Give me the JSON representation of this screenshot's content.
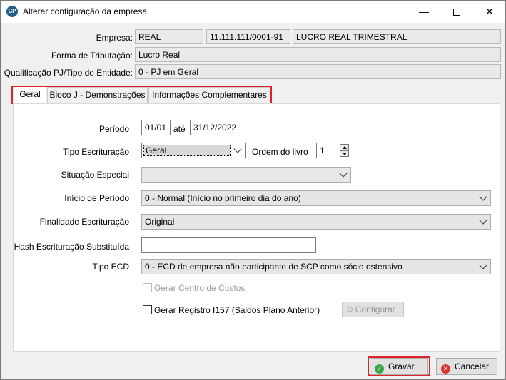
{
  "window": {
    "app_icon_text": "CP",
    "title": "Alterar configuração da empresa",
    "minimize": "—",
    "close": "✕"
  },
  "header": {
    "empresa_label": "Empresa:",
    "empresa_name": "REAL",
    "empresa_cnpj": "11.111.111/0001-91",
    "empresa_regime": "LUCRO REAL TRIMESTRAL",
    "forma_label": "Forma de Tributação:",
    "forma_value": "Lucro Real",
    "qualificacao_label": "Qualificação PJ/Tipo de Entidade:",
    "qualificacao_value": "0 - PJ em Geral"
  },
  "tabs": [
    {
      "label": "Geral",
      "active": true
    },
    {
      "label": "Bloco J - Demonstrações",
      "active": false
    },
    {
      "label": "Informações Complementares",
      "active": false
    }
  ],
  "form": {
    "periodo_label": "Período",
    "periodo_inicio": "01/01",
    "ate_label": "até",
    "periodo_fim": "31/12/2022",
    "tipo_label": "Tipo Escrituração",
    "tipo_value": "Geral",
    "ordem_label": "Ordem do livro",
    "ordem_value": "1",
    "situacao_label": "Situação Especial",
    "situacao_value": "",
    "inicio_label": "Início de Período",
    "inicio_value": "0 - Normal (Início no primeiro dia do ano)",
    "finalidade_label": "Finalidade Escrituração",
    "finalidade_value": "Original",
    "hash_label": "Hash Escrituração Substituída",
    "hash_value": "",
    "tipo_ecd_label": "Tipo ECD",
    "tipo_ecd_value": "0 - ECD de empresa não participante de SCP como sócio ostensivo",
    "centro_custos_label": "Gerar Centro de Custos",
    "i157_label": "Gerar Registro I157 (Saldos Plano Anterior)",
    "configurar_label": "Configurar"
  },
  "footer": {
    "gravar_label": "Gravar",
    "cancelar_label": "Cancelar"
  },
  "colors": {
    "highlight": "#e0202b",
    "ok_green": "#3aa845",
    "cancel_red": "#d9342b"
  }
}
